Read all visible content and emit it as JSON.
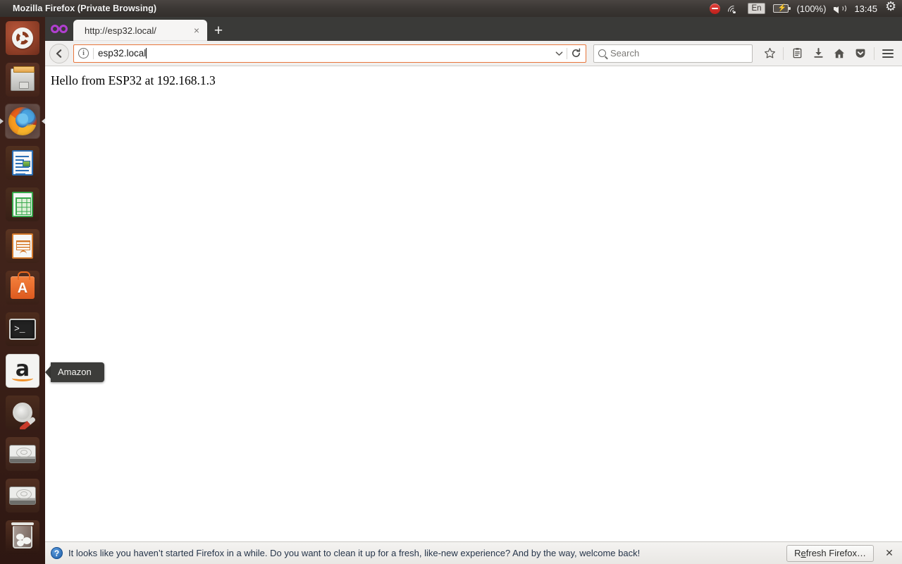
{
  "panel": {
    "window_title": "Mozilla Firefox (Private Browsing)",
    "battery_percent": "(100%)",
    "keyboard_layout": "En",
    "clock": "13:45",
    "icons": [
      "do-not-disturb-icon",
      "wifi-icon",
      "keyboard-indicator",
      "battery-icon",
      "volume-icon",
      "session-gear-icon"
    ]
  },
  "launcher": {
    "items": [
      {
        "name": "ubuntu-dash",
        "label": "Ubuntu Dash"
      },
      {
        "name": "files",
        "label": "Files"
      },
      {
        "name": "firefox",
        "label": "Firefox Web Browser"
      },
      {
        "name": "libreoffice-writer",
        "label": "LibreOffice Writer"
      },
      {
        "name": "libreoffice-calc",
        "label": "LibreOffice Calc"
      },
      {
        "name": "libreoffice-impress",
        "label": "LibreOffice Impress"
      },
      {
        "name": "ubuntu-software",
        "label": "Ubuntu Software Center"
      },
      {
        "name": "terminal",
        "label": "Terminal"
      },
      {
        "name": "amazon",
        "label": "Amazon"
      },
      {
        "name": "system-settings",
        "label": "System Settings"
      },
      {
        "name": "disk-1",
        "label": "Disk"
      },
      {
        "name": "disk-2",
        "label": "Disk"
      },
      {
        "name": "trash",
        "label": "Trash"
      }
    ],
    "tooltip": {
      "label": "Amazon"
    },
    "software_badge": "A",
    "terminal_prompt": ">_"
  },
  "browser": {
    "tabs": [
      {
        "title": "http://esp32.local/",
        "close_label": "×"
      }
    ],
    "new_tab_label": "+",
    "private_icon": "private-browsing-mask-icon",
    "back_label": "←",
    "urlbar": {
      "value": "esp32.local",
      "identity_label": "i",
      "dropmarker": "⌄"
    },
    "reload_label": "⟳",
    "search": {
      "placeholder": "Search"
    },
    "toolbar_icons": [
      {
        "name": "bookmark-star-icon",
        "glyph": "☆"
      },
      {
        "name": "library-icon",
        "glyph": "▤"
      },
      {
        "name": "downloads-icon",
        "glyph": "⬇"
      },
      {
        "name": "home-icon",
        "glyph": "⌂"
      },
      {
        "name": "pocket-icon",
        "glyph": "▼"
      },
      {
        "name": "menu-hamburger-icon",
        "glyph": "≡"
      }
    ]
  },
  "page": {
    "body_text": "Hello from ESP32 at 192.168.1.3"
  },
  "notification": {
    "icon": "?",
    "message": "It looks like you haven’t started Firefox in a while. Do you want to clean it up for a fresh, like-new experience? And by the way, welcome back!",
    "button_prefix": "R",
    "button_accesskey": "e",
    "button_suffix": "fresh Firefox…",
    "close_label": "✕"
  },
  "colors": {
    "launcher_bg": "#3b1f18",
    "panel_bg": "#3b3734",
    "tabstrip_bg": "#3a3a38",
    "toolbar_bg": "#f1f0ef",
    "urlbar_focus_border": "#e8763c",
    "private_purple": "#b03fd0",
    "notification_text": "#26354a"
  }
}
